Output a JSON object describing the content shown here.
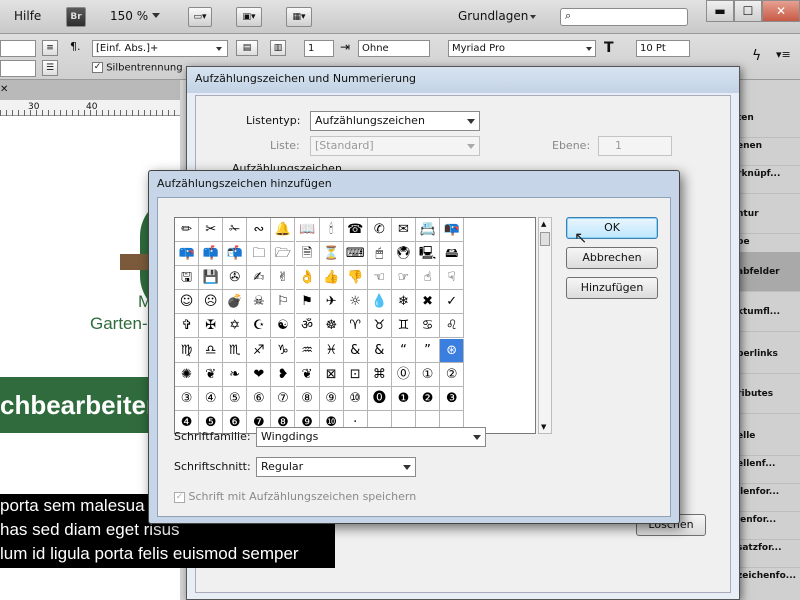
{
  "menubar": {
    "help": "Hilfe",
    "br": "Br",
    "zoom": "150 %",
    "workspace": "Grundlagen"
  },
  "ctrl": {
    "para_style": "[Einf. Abs.]+",
    "hyphenation": "Silbentrennung",
    "indent": "1",
    "none": "Ohne",
    "font": "Myriad Pro",
    "size": "10 Pt"
  },
  "ruler": {
    "marks": [
      "30",
      "40"
    ]
  },
  "document": {
    "initial": "M",
    "tagline": "Garten-",
    "banner": "chbearbeiter",
    "body": [
      "porta sem malesua",
      "has sed diam eget risus",
      "lum id ligula porta felis euismod semper"
    ]
  },
  "panels": {
    "items": [
      "ten",
      "enen",
      "rknüpf...",
      "ntur",
      "be",
      "abfelder",
      "ktumfl...",
      "perlinks",
      "ributes",
      "elle",
      "ellenf...",
      "llenfor...",
      "lenfor...",
      "satzfor...",
      "zeichenfo..."
    ]
  },
  "outer": {
    "title": "Aufzählungszeichen und Nummerierung",
    "list_type_label": "Listentyp:",
    "list_type_value": "Aufzählungszeichen",
    "list_label": "Liste:",
    "list_value": "[Standard]",
    "level_label": "Ebene:",
    "level_value": "1",
    "section_label": "Aufzählungszeichen",
    "hidden_btn": "Löschen"
  },
  "inner": {
    "title": "Aufzählungszeichen hinzufügen",
    "glyphs": [
      [
        "✏",
        "✂",
        "✁",
        "∾",
        "🔔",
        "📖",
        "🕯",
        "☎",
        "✆",
        "✉",
        "📇",
        "📭"
      ],
      [
        "📪",
        "📫",
        "📬",
        "🗀",
        "🗁",
        "🗎",
        "⏳",
        "⌨",
        "🖱",
        "🖲",
        "🖳",
        "🖴"
      ],
      [
        "🖫",
        "💾",
        "✇",
        "✍",
        "✌",
        "👌",
        "👍",
        "👎",
        "☜",
        "☞",
        "☝",
        "☟"
      ],
      [
        "☺",
        "☹",
        "💣",
        "☠",
        "⚐",
        "⚑",
        "✈",
        "☼",
        "💧",
        "❄",
        "✖",
        "✓"
      ],
      [
        "✞",
        "✠",
        "✡",
        "☪",
        "☯",
        "ॐ",
        "☸",
        "♈",
        "♉",
        "♊",
        "♋",
        "♌"
      ],
      [
        "♍",
        "♎",
        "♏",
        "♐",
        "♑",
        "♒",
        "♓",
        "&",
        "&",
        "“",
        "”",
        "⊛"
      ],
      [
        "✺",
        "❦",
        "❧",
        "❤",
        "❥",
        "❦",
        "⊠",
        "⊡",
        "⌘",
        "⓪",
        "①",
        "②"
      ],
      [
        "③",
        "④",
        "⑤",
        "⑥",
        "⑦",
        "⑧",
        "⑨",
        "⑩",
        "⓿",
        "❶",
        "❷",
        "❸"
      ],
      [
        "❹",
        "❺",
        "❻",
        "❼",
        "❽",
        "❾",
        "❿",
        "·",
        "",
        "",
        "",
        ""
      ]
    ],
    "font_family_label": "Schriftfamilie:",
    "font_family_value": "Wingdings",
    "font_style_label": "Schriftschnitt:",
    "font_style_value": "Regular",
    "save_font_label": "Schrift mit Aufzählungszeichen speichern",
    "ok": "OK",
    "cancel": "Abbrechen",
    "add": "Hinzufügen"
  }
}
